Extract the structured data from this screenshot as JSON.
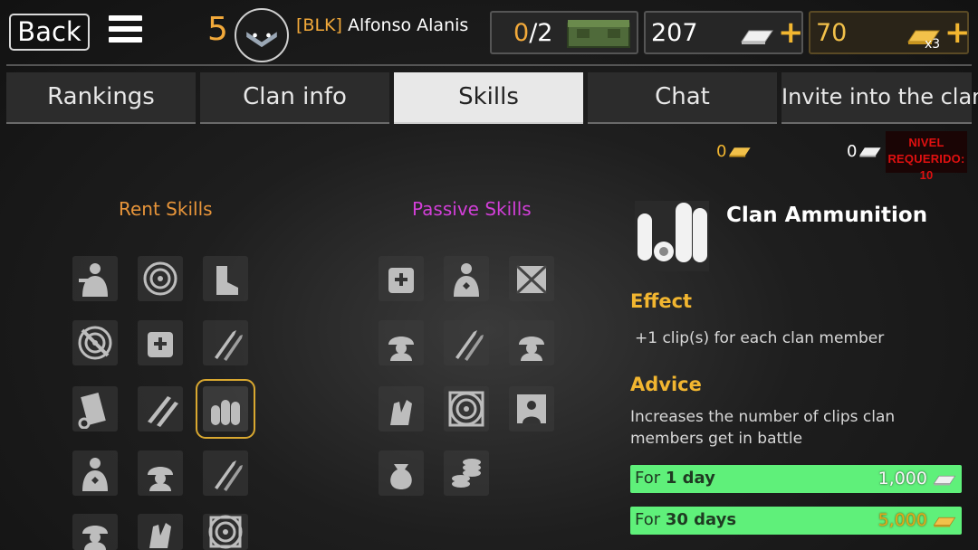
{
  "top_bar": {
    "back_label": "Back",
    "level": "5",
    "clan_tag": "[BLK]",
    "player_name": "Alfonso Alanis"
  },
  "resources": {
    "crates_current": "0",
    "crates_total": "/2",
    "silver": "207",
    "gold": "70",
    "gold_multiplier": "x3"
  },
  "tabs": [
    {
      "label": "Rankings",
      "active": false
    },
    {
      "label": "Clan info",
      "active": false
    },
    {
      "label": "Skills",
      "active": true
    },
    {
      "label": "Chat",
      "active": false
    },
    {
      "label": "Invite into the clan",
      "active": false
    }
  ],
  "clan_funds": {
    "gold": "0",
    "silver": "0",
    "level_required_line1": "NIVEL",
    "level_required_line2": "REQUERIDO: 10"
  },
  "rent_skills": {
    "title": "Rent Skills",
    "icons": [
      "soldier-aiming-icon",
      "target-icon",
      "boot-icon",
      "no-sniper-icon",
      "medkit-bag-icon",
      "grenades-icon",
      "ammo-belt-icon",
      "bullets-flying-icon",
      "clan-ammunition-icon",
      "soldier-badge-icon",
      "soldier-scope-icon",
      "knives-icon",
      "helmet-soldier-icon",
      "hand-ammo-icon",
      "scope-crate-icon"
    ],
    "selected": "clan-ammunition-icon"
  },
  "passive_skills": {
    "title": "Passive Skills",
    "icons": [
      "medkit-bag-icon",
      "soldier-badge-icon",
      "ammo-crate-icon",
      "soldier-scope-icon",
      "knives-icon",
      "helmet-soldier-icon",
      "hand-ammo-icon",
      "target-frame-icon",
      "flag-soldier-icon",
      "money-bag-icon",
      "coin-stack-icon"
    ]
  },
  "detail": {
    "name": "Clan Ammunition",
    "effect_title": "Effect",
    "effect_text": "+1 clip(s) for each clan member",
    "advice_title": "Advice",
    "advice_text": "Increases the number of clips clan members get in battle",
    "options": [
      {
        "prefix": "For ",
        "duration": "1 day",
        "price": "1,000",
        "currency": "silver"
      },
      {
        "prefix": "For ",
        "duration": "30 days",
        "price": "5,000",
        "currency": "gold"
      }
    ]
  },
  "colors": {
    "accent_orange": "#f2a93a",
    "passive_purple": "#d23fd8",
    "buy_green": "#5ff07a",
    "level_red": "#e01010"
  }
}
